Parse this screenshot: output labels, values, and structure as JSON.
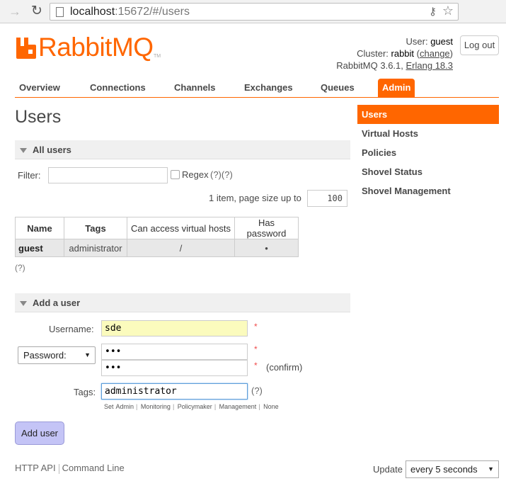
{
  "browser": {
    "url_host": "localhost",
    "url_path": ":15672/#/users"
  },
  "header": {
    "logo_text": "RabbitMQ",
    "logo_tm": "TM",
    "user_prefix": "User:",
    "user_name": "guest",
    "cluster_prefix": "Cluster:",
    "cluster_name": "rabbit",
    "change_link": "change",
    "version": "RabbitMQ 3.6.1,",
    "erlang": "Erlang 18.3",
    "logout": "Log out"
  },
  "tabs": [
    {
      "label": "Overview"
    },
    {
      "label": "Connections"
    },
    {
      "label": "Channels"
    },
    {
      "label": "Exchanges"
    },
    {
      "label": "Queues"
    },
    {
      "label": "Admin"
    }
  ],
  "page_title": "Users",
  "all_users": {
    "heading": "All users",
    "filter_label": "Filter:",
    "filter_value": "",
    "regex_label": "Regex",
    "regex_help": "(?)(?)",
    "count_text": "1 item, page size up to",
    "page_size": "100",
    "columns": [
      "Name",
      "Tags",
      "Can access virtual hosts",
      "Has password"
    ],
    "rows": [
      {
        "name": "guest",
        "tags": "administrator",
        "vhosts": "/",
        "has_password": "•"
      }
    ],
    "help": "(?)"
  },
  "add_user": {
    "heading": "Add a user",
    "username_label": "Username:",
    "username_value": "sde",
    "password_mode": "Password:",
    "password_value": "•••",
    "confirm_value": "•••",
    "confirm_label": "(confirm)",
    "required_mark": "*",
    "tags_label": "Tags:",
    "tags_value": "administrator",
    "tags_help": "(?)",
    "tag_presets": [
      "Set",
      "Admin",
      "Monitoring",
      "Policymaker",
      "Management",
      "None"
    ],
    "submit": "Add user"
  },
  "sidebar": [
    {
      "label": "Users"
    },
    {
      "label": "Virtual Hosts"
    },
    {
      "label": "Policies"
    },
    {
      "label": "Shovel Status"
    },
    {
      "label": "Shovel Management"
    }
  ],
  "footer": {
    "http_api": "HTTP API",
    "command_line": "Command Line",
    "update_label": "Update",
    "update_value": "every 5 seconds"
  },
  "colors": {
    "accent": "#ff6600",
    "button": "#c4c4f6",
    "input_highlight": "#fbfbbd"
  }
}
